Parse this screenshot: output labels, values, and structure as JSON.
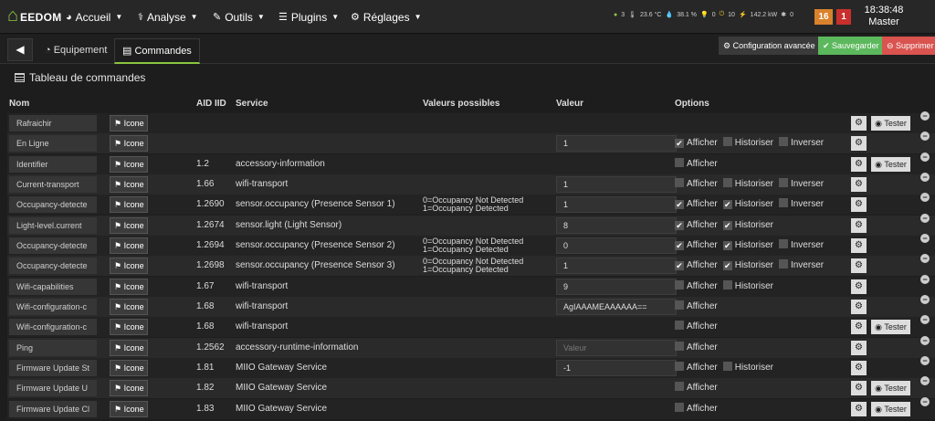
{
  "brand": {
    "logo_text": "EEDOM"
  },
  "nav": {
    "accueil": "Accueil",
    "analyse": "Analyse",
    "outils": "Outils",
    "plugins": "Plugins",
    "reglages": "Réglages"
  },
  "stats": {
    "people": "3",
    "temp": "23.6 °C",
    "humidity": "38.1 %",
    "bulbs": "0",
    "plugs": "10",
    "power": "142.2 kW",
    "misc": "0"
  },
  "badges": {
    "orange": "16",
    "red": "1"
  },
  "clock": {
    "time": "18:38:48",
    "label": "Master"
  },
  "tabs": {
    "equipement": "Equipement",
    "commandes": "Commandes"
  },
  "actions": {
    "config": "Configuration avancée",
    "save": "Sauvegarder",
    "delete": "Supprimer"
  },
  "section": {
    "title": "Tableau de commandes"
  },
  "headers": {
    "nom": "Nom",
    "aid": "AID IID",
    "service": "Service",
    "valeurs": "Valeurs possibles",
    "valeur": "Valeur",
    "options": "Options"
  },
  "labels": {
    "icone": "Icone",
    "afficher": "Afficher",
    "historiser": "Historiser",
    "inverser": "Inverser",
    "tester": "Tester",
    "placeholder": "Valeur"
  },
  "colors": {
    "accent": "#8ac640",
    "save": "#5cb85c",
    "delete": "#d9534f",
    "badge_orange": "#d9822b",
    "badge_red": "#c9302c"
  },
  "rows": [
    {
      "name": "Rafraichir",
      "aid": "",
      "service": "",
      "vp": "",
      "value": "",
      "afficher": null,
      "historiser": null,
      "inverser": null,
      "tester": true
    },
    {
      "name": "En Ligne",
      "aid": "",
      "service": "",
      "vp": "",
      "value": "1",
      "afficher": true,
      "historiser": false,
      "inverser": false,
      "tester": false
    },
    {
      "name": "Identifier",
      "aid": "1.2",
      "service": "accessory-information",
      "vp": "",
      "value": "",
      "afficher": false,
      "historiser": null,
      "inverser": null,
      "tester": true
    },
    {
      "name": "Current-transport",
      "aid": "1.66",
      "service": "wifi-transport",
      "vp": "",
      "value": "1",
      "afficher": false,
      "historiser": false,
      "inverser": false,
      "tester": false
    },
    {
      "name": "Occupancy-detecte",
      "aid": "1.2690",
      "service": "sensor.occupancy (Presence Sensor 1)",
      "vp": "0=Occupancy Not Detected\n1=Occupancy Detected",
      "value": "1",
      "afficher": true,
      "historiser": true,
      "inverser": false,
      "tester": false
    },
    {
      "name": "Light-level.current",
      "aid": "1.2674",
      "service": "sensor.light (Light Sensor)",
      "vp": "",
      "value": "8",
      "afficher": true,
      "historiser": true,
      "inverser": null,
      "tester": false
    },
    {
      "name": "Occupancy-detecte",
      "aid": "1.2694",
      "service": "sensor.occupancy (Presence Sensor 2)",
      "vp": "0=Occupancy Not Detected\n1=Occupancy Detected",
      "value": "0",
      "afficher": true,
      "historiser": true,
      "inverser": false,
      "tester": false
    },
    {
      "name": "Occupancy-detecte",
      "aid": "1.2698",
      "service": "sensor.occupancy (Presence Sensor 3)",
      "vp": "0=Occupancy Not Detected\n1=Occupancy Detected",
      "value": "1",
      "afficher": true,
      "historiser": true,
      "inverser": false,
      "tester": false
    },
    {
      "name": "Wifi-capabilities",
      "aid": "1.67",
      "service": "wifi-transport",
      "vp": "",
      "value": "9",
      "afficher": false,
      "historiser": false,
      "inverser": null,
      "tester": false
    },
    {
      "name": "Wifi-configuration-c",
      "aid": "1.68",
      "service": "wifi-transport",
      "vp": "",
      "value": "AgIAAAMEAAAAAA==",
      "afficher": false,
      "historiser": null,
      "inverser": null,
      "tester": false
    },
    {
      "name": "Wifi-configuration-c",
      "aid": "1.68",
      "service": "wifi-transport",
      "vp": "",
      "value": "",
      "afficher": false,
      "historiser": null,
      "inverser": null,
      "tester": true
    },
    {
      "name": "Ping",
      "aid": "1.2562",
      "service": "accessory-runtime-information",
      "vp": "",
      "value": "",
      "placeholder": true,
      "afficher": false,
      "historiser": null,
      "inverser": null,
      "tester": false
    },
    {
      "name": "Firmware Update St",
      "aid": "1.81",
      "service": "MIIO Gateway Service",
      "vp": "",
      "value": "-1",
      "afficher": false,
      "historiser": false,
      "inverser": null,
      "tester": false
    },
    {
      "name": "Firmware Update U",
      "aid": "1.82",
      "service": "MIIO Gateway Service",
      "vp": "",
      "value": "",
      "afficher": false,
      "historiser": null,
      "inverser": null,
      "tester": true
    },
    {
      "name": "Firmware Update Cl",
      "aid": "1.83",
      "service": "MIIO Gateway Service",
      "vp": "",
      "value": "",
      "afficher": false,
      "historiser": null,
      "inverser": null,
      "tester": true
    }
  ]
}
